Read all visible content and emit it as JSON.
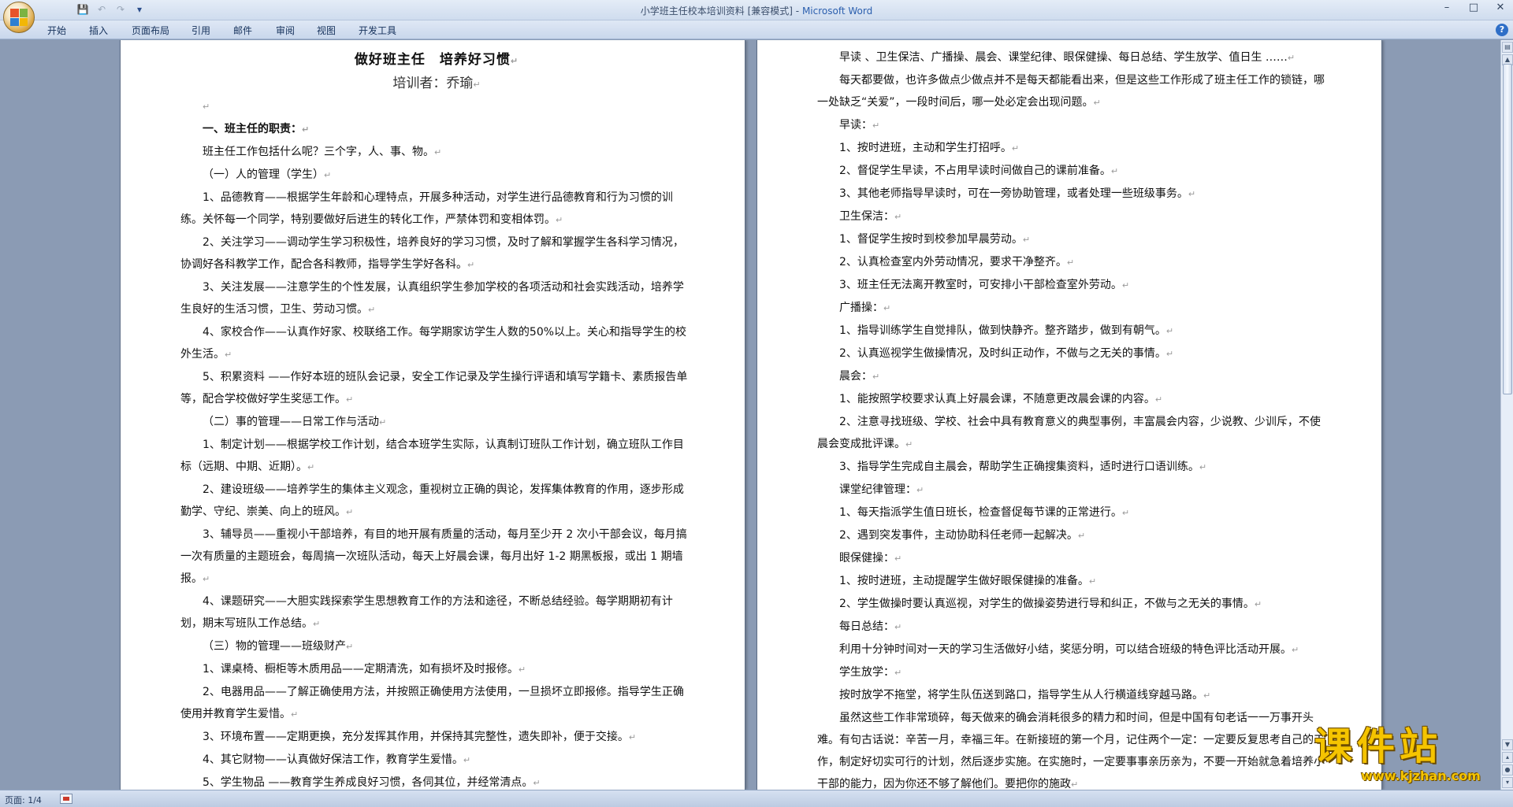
{
  "window": {
    "title_doc": "小学班主任校本培训资料 [兼容模式]",
    "title_sep": " - ",
    "title_app": "Microsoft Word",
    "controls": {
      "minimize": "–",
      "maximize": "□",
      "close": "✕"
    }
  },
  "qat": {
    "save": "💾",
    "undo": "↶",
    "redo": "↷",
    "more": "▾"
  },
  "ribbon": {
    "tabs": [
      "开始",
      "插入",
      "页面布局",
      "引用",
      "邮件",
      "审阅",
      "视图",
      "开发工具"
    ],
    "help": "?"
  },
  "page_left": {
    "title": "做好班主任　培养好习惯",
    "subtitle": "培训者：乔瑜",
    "paragraphs": [
      "",
      "一、班主任的职责：",
      "班主任工作包括什么呢？三个字，人、事、物。",
      "（一）人的管理（学生）",
      "1、品德教育——根据学生年龄和心理特点，开展多种活动，对学生进行品德教育和行为习惯的训练。关怀每一个同学，特别要做好后进生的转化工作，严禁体罚和变相体罚。",
      "2、关注学习——调动学生学习积极性，培养良好的学习习惯，及时了解和掌握学生各科学习情况，协调好各科教学工作，配合各科教师，指导学生学好各科。",
      "3、关注发展——注意学生的个性发展，认真组织学生参加学校的各项活动和社会实践活动，培养学生良好的生活习惯，卫生、劳动习惯。",
      "4、家校合作——认真作好家、校联络工作。每学期家访学生人数的50%以上。关心和指导学生的校外生活。",
      "5、积累资料 ——作好本班的班队会记录，安全工作记录及学生操行评语和填写学籍卡、素质报告单等，配合学校做好学生奖惩工作。",
      "（二）事的管理——日常工作与活动",
      "1、制定计划——根据学校工作计划，结合本班学生实际，认真制订班队工作计划，确立班队工作目标（远期、中期、近期）。",
      "2、建设班级——培养学生的集体主义观念，重视树立正确的舆论，发挥集体教育的作用，逐步形成勤学、守纪、崇美、向上的班风。",
      "3、辅导员——重视小干部培养，有目的地开展有质量的活动，每月至少开 2 次小干部会议，每月搞一次有质量的主题班会，每周搞一次班队活动，每天上好晨会课，每月出好 1-2 期黑板报，或出 1 期墙报。",
      "4、课题研究——大胆实践探索学生思想教育工作的方法和途径，不断总结经验。每学期期初有计划，期末写班队工作总结。",
      "（三）物的管理——班级财产",
      "1、课桌椅、橱柜等木质用品——定期清洗，如有损坏及时报修。",
      "2、电器用品——了解正确使用方法，并按照正确使用方法使用，一旦损坏立即报修。指导学生正确使用并教育学生爱惜。",
      "3、环境布置——定期更换，充分发挥其作用，并保持其完整性，遗失即补，便于交接。",
      "4、其它财物——认真做好保洁工作，教育学生爱惜。",
      "5、学生物品 ——教育学生养成良好习惯，各伺其位，并经常清点。"
    ]
  },
  "page_right": {
    "paragraphs": [
      "早读 、卫生保洁、广播操、晨会、课堂纪律、眼保健操、每日总结、学生放学、值日生 ……",
      "每天都要做，也许多做点少做点并不是每天都能看出来，但是这些工作形成了班主任工作的锁链，哪一处缺乏“关爱”，一段时间后，哪一处必定会出现问题。",
      "早读：",
      "1、按时进班，主动和学生打招呼。",
      "2、督促学生早读，不占用早读时间做自己的课前准备。",
      "3、其他老师指导早读时，可在一旁协助管理，或者处理一些班级事务。",
      "卫生保洁：",
      "1、督促学生按时到校参加早晨劳动。",
      "2、认真检查室内外劳动情况，要求干净整齐。",
      "3、班主任无法离开教室时，可安排小干部检查室外劳动。",
      "广播操：",
      "1、指导训练学生自觉排队，做到快静齐。整齐踏步，做到有朝气。",
      "2、认真巡视学生做操情况，及时纠正动作，不做与之无关的事情。",
      "晨会：",
      "1、能按照学校要求认真上好晨会课，不随意更改晨会课的内容。",
      "2、注意寻找班级、学校、社会中具有教育意义的典型事例，丰富晨会内容，少说教、少训斥，不使晨会变成批评课。",
      "3、指导学生完成自主晨会，帮助学生正确搜集资料，适时进行口语训练。",
      "课堂纪律管理：",
      "1、每天指派学生值日班长，检查督促每节课的正常进行。",
      "2、遇到突发事件，主动协助科任老师一起解决。",
      "眼保健操：",
      "1、按时进班，主动提醒学生做好眼保健操的准备。",
      "2、学生做操时要认真巡视，对学生的做操姿势进行导和纠正，不做与之无关的事情。",
      "每日总结：",
      "利用十分钟时间对一天的学习生活做好小结，奖惩分明，可以结合班级的特色评比活动开展。",
      "学生放学：",
      "按时放学不拖堂，将学生队伍送到路口，指导学生从人行横道线穿越马路。",
      "虽然这些工作非常琐碎，每天做来的确会消耗很多的精力和时间，但是中国有句老话一一万事开头难。有句古话说：辛苦一月，幸福三年。在新接班的第一个月，记住两个一定：一定要反复思考自己的工作，制定好切实可行的计划，然后逐步实施。在实施时，一定要事事亲历亲为，不要一开始就急着培养小干部的能力，因为你还不够了解他们。要把你的施政"
    ]
  },
  "statusbar": {
    "page": "页面: 1/4"
  },
  "watermark": {
    "brand": "课件站",
    "url": "www.kjzhan.com"
  },
  "colors": {
    "workspace": "#8b9bb4",
    "brand_yellow": "#f5c400",
    "ribbon": "#cfdcee"
  },
  "icons": [
    "office-logo-icon",
    "save-icon",
    "undo-icon",
    "redo-icon",
    "help-icon",
    "paragraph-mark-icon",
    "macro-status-icon"
  ]
}
